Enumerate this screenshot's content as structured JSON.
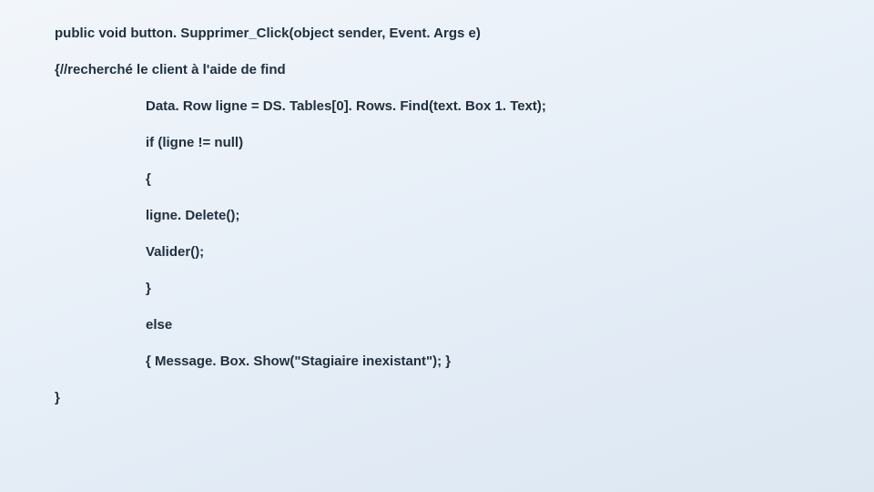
{
  "code": {
    "l1": "public void button. Supprimer_Click(object sender, Event. Args e)",
    "l2": "{//recherché le client à l'aide de find",
    "l3": "Data. Row ligne = DS. Tables[0]. Rows. Find(text. Box 1. Text);",
    "l4": "if (ligne != null)",
    "l5": "{",
    "l6": "ligne. Delete();",
    "l7": "Valider();",
    "l8": "}",
    "l9": "else",
    "l10": "{ Message. Box. Show(\"Stagiaire inexistant\"); }",
    "l11": "}"
  }
}
